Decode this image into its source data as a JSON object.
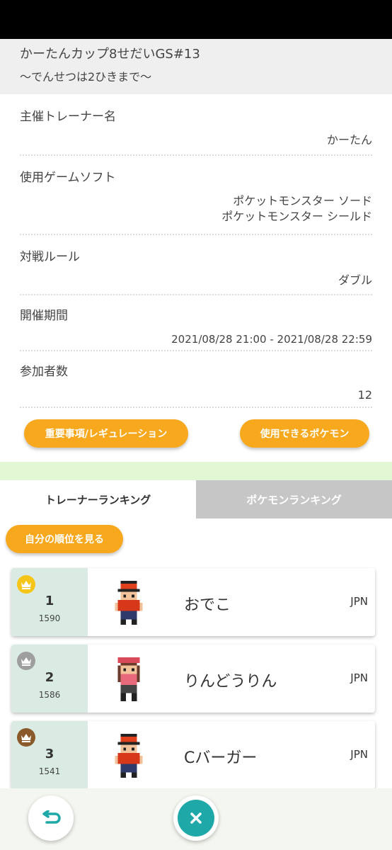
{
  "tournament": {
    "title": "かーたんカップ8せだいGS#13",
    "subtitle": "〜でんせつは2ひきまで〜"
  },
  "details": [
    {
      "label": "主催トレーナー名",
      "values": [
        "かーたん"
      ]
    },
    {
      "label": "使用ゲームソフト",
      "values": [
        "ポケットモンスター ソード",
        "ポケットモンスター シールド"
      ]
    },
    {
      "label": "対戦ルール",
      "values": [
        "ダブル"
      ]
    },
    {
      "label": "開催期間",
      "values": [
        "2021/08/28 21:00 - 2021/08/28 22:59"
      ]
    },
    {
      "label": "参加者数",
      "values": [
        "12"
      ]
    }
  ],
  "buttons": {
    "regulation": "重要事項/レギュレーション",
    "usable_pokemon": "使用できるポケモン",
    "my_rank": "自分の順位を見る"
  },
  "tabs": [
    {
      "label": "トレーナーランキング",
      "active": true
    },
    {
      "label": "ポケモンランキング",
      "active": false
    }
  ],
  "ranking": [
    {
      "rank": "1",
      "rating": "1590",
      "name": "おでこ",
      "country": "JPN",
      "crown_color": "#f5c518",
      "sprite": "red-cap-trainer-icon"
    },
    {
      "rank": "2",
      "rating": "1586",
      "name": "りんどうりん",
      "country": "JPN",
      "crown_color": "#9e9e9e",
      "sprite": "red-bandana-trainer-icon"
    },
    {
      "rank": "3",
      "rating": "1541",
      "name": "Cバーガー",
      "country": "JPN",
      "crown_color": "#8a5a2b",
      "sprite": "red-cap-trainer-icon"
    }
  ],
  "bottom": {
    "back_icon": "back-arrow-icon",
    "close_icon": "close-icon",
    "accent": "#1fa8a8"
  }
}
